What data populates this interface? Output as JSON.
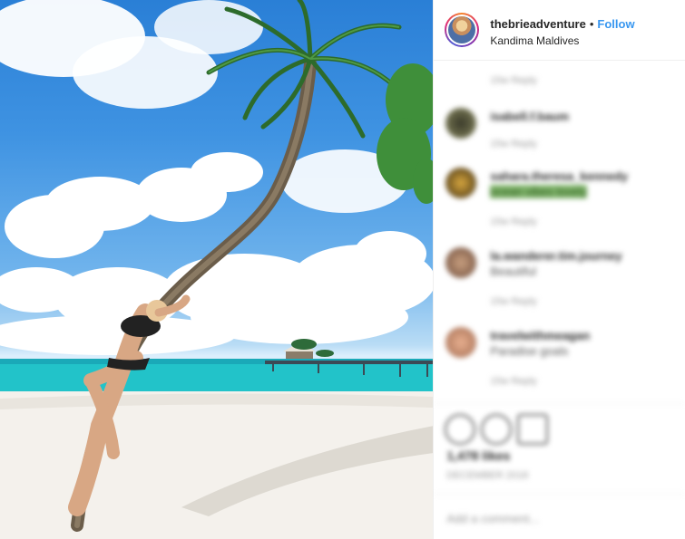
{
  "header": {
    "username": "thebrieadventure",
    "separator": "•",
    "follow_label": "Follow",
    "location": "Kandima Maldives"
  },
  "comments": [
    {
      "author": "",
      "text": "",
      "time": "15w Reply"
    },
    {
      "author": "isabell.f.baum",
      "text": "",
      "time": "15w Reply"
    },
    {
      "author": "sahara.theresa_kennedy",
      "text": "ocean vibes lovely",
      "time": "15w Reply"
    },
    {
      "author": "la.wanderer.tim.journey",
      "text": "Beautiful",
      "time": "15w Reply"
    },
    {
      "author": "travelwithmeagan",
      "text": "Paradise goals",
      "time": "15w Reply"
    }
  ],
  "actions": {
    "like_icon": "heart-icon",
    "comment_icon": "comment-icon",
    "share_icon": "share-icon",
    "likes": "1,478 likes",
    "date": "DECEMBER 2018",
    "add_comment_placeholder": "Add a comment..."
  },
  "colors": {
    "follow": "#3897f0",
    "text": "#262626",
    "sky": "#3f93e2",
    "sea": "#22c3c9"
  }
}
